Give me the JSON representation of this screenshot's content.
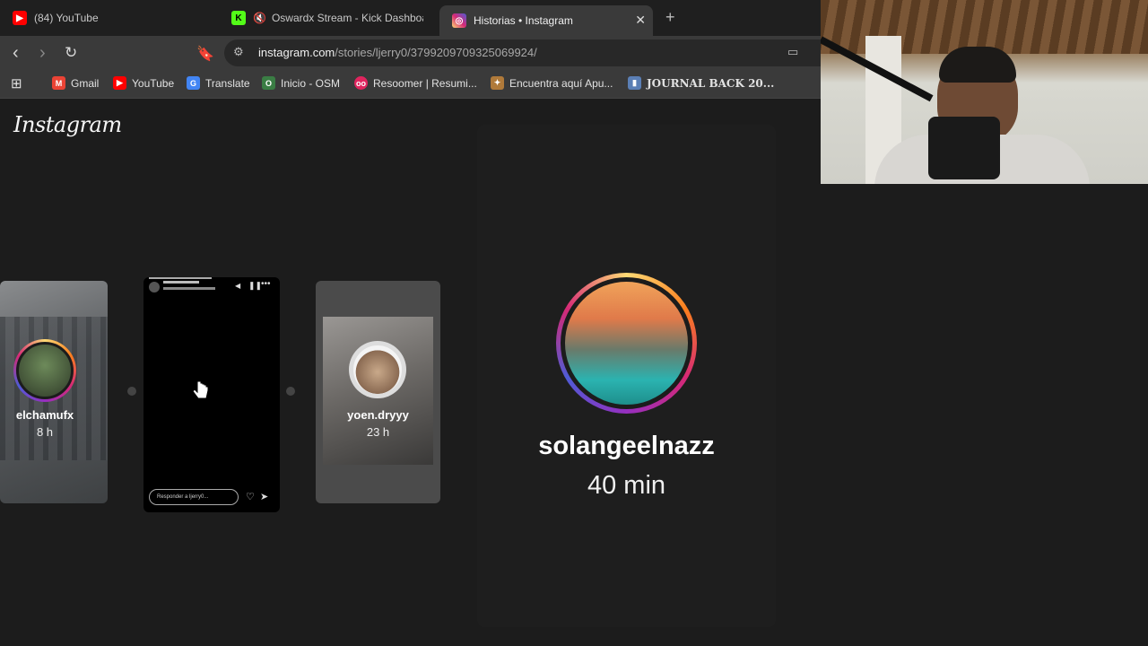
{
  "browser": {
    "tabs": [
      {
        "title": "(84) YouTube",
        "fav_color": "#ff0000",
        "fav_glyph": "▶"
      },
      {
        "title": "Oswardx Stream - Kick Dashboard",
        "fav_color": "#53fc18",
        "fav_glyph": "K"
      },
      {
        "title": "Historias • Instagram",
        "fav_color": "#d62976",
        "fav_glyph": "◎",
        "active": true
      }
    ],
    "close_glyph": "✕",
    "new_tab_glyph": "+",
    "url_host": "instagram.com",
    "url_path": "/stories/ljerry0/3799209709325069924/",
    "bookmarks": [
      {
        "label": "Gmail",
        "icon": "gmail-icon",
        "color": "#ea4335",
        "glyph": "M"
      },
      {
        "label": "YouTube",
        "icon": "youtube-icon",
        "color": "#ff0000",
        "glyph": "▶"
      },
      {
        "label": "Translate",
        "icon": "translate-icon",
        "color": "#4285f4",
        "glyph": "G"
      },
      {
        "label": "Inicio - OSM",
        "icon": "osm-icon",
        "color": "#3a7d44",
        "glyph": "O"
      },
      {
        "label": "Resoomer | Resumi...",
        "icon": "resoomer-icon",
        "color": "#e0245e",
        "glyph": "oo"
      },
      {
        "label": "Encuentra aquí Apu...",
        "icon": "apuntes-icon",
        "color": "#b07a3a",
        "glyph": "✦"
      },
      {
        "label": "JOURNAL BACK 20...",
        "icon": "journal-icon",
        "color": "#5b7fb5",
        "glyph": "▮"
      }
    ]
  },
  "instagram": {
    "logo": "Instagram",
    "stories": [
      {
        "username": "elchamufx",
        "time": "8 h"
      },
      {
        "username": "yoen.dryyy",
        "time": "23 h"
      }
    ],
    "current_story": {
      "reply_placeholder": "Responder a ljerry0..."
    },
    "featured": {
      "username": "solangeelnazz",
      "time": "40 min"
    }
  }
}
